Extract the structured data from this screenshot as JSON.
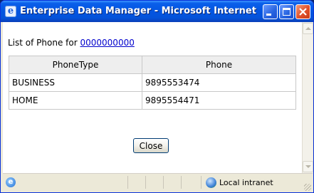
{
  "window": {
    "title": "Enterprise Data Manager - Microsoft Internet Explorer"
  },
  "content": {
    "heading_prefix": "List of Phone for",
    "heading_link": "0000000000",
    "table": {
      "columns": [
        "PhoneType",
        "Phone"
      ],
      "rows": [
        {
          "type": "BUSINESS",
          "phone": "9895553474"
        },
        {
          "type": "HOME",
          "phone": "9895554471"
        }
      ]
    },
    "close_button": "Close"
  },
  "statusbar": {
    "zone": "Local intranet"
  },
  "icons": {
    "app": "ie-icon",
    "status": "page-icon",
    "zone": "globe-icon"
  }
}
